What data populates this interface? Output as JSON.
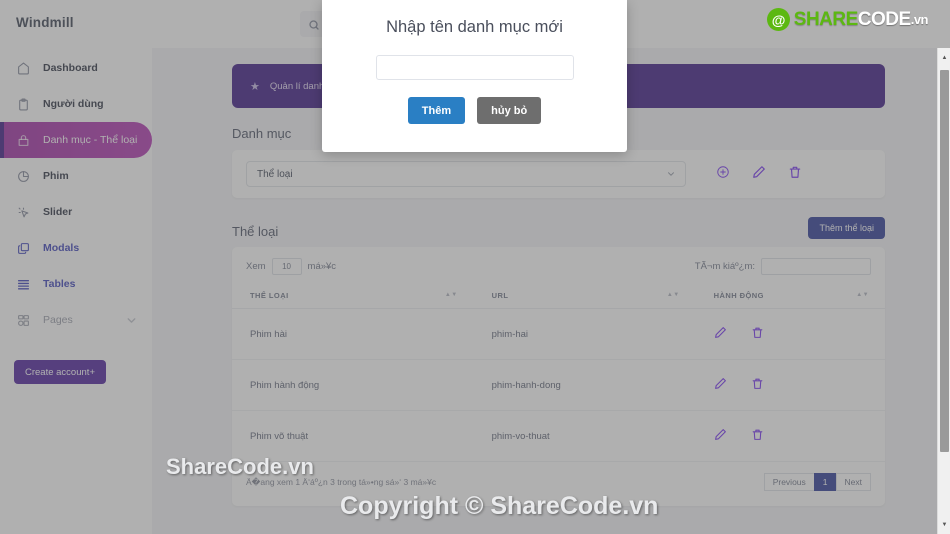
{
  "sidebar": {
    "brand": "Windmill",
    "items": [
      {
        "label": "Dashboard",
        "icon": "home-icon",
        "style": "dark"
      },
      {
        "label": "Người dùng",
        "icon": "clipboard-icon",
        "style": "dark"
      },
      {
        "label": "Danh mục - Thể loại",
        "icon": "bag-icon",
        "style": "active"
      },
      {
        "label": "Phim",
        "icon": "pie-chart-icon",
        "style": "dark"
      },
      {
        "label": "Slider",
        "icon": "cursor-icon",
        "style": "dark"
      },
      {
        "label": "Modals",
        "icon": "layers-icon",
        "style": "blue"
      },
      {
        "label": "Tables",
        "icon": "table-icon",
        "style": "blue"
      },
      {
        "label": "Pages",
        "icon": "grid-icon",
        "style": "muted"
      }
    ],
    "create_account_label": "Create account",
    "create_account_plus": "+"
  },
  "topbar": {
    "search_placeholder": "",
    "search_value": ""
  },
  "logo": {
    "share": "SHARE",
    "code": "CODE",
    "vn": ".vn",
    "mark": "@"
  },
  "banner": {
    "star": "★",
    "text": "Quản lí danh mục"
  },
  "section": {
    "category_heading": "Danh mục",
    "select_value": "Thể loại",
    "genre_heading": "Thể loại",
    "add_genre_button": "Thêm thể loại"
  },
  "table": {
    "length_prefix": "Xem",
    "length_value": "10",
    "length_suffix": "má»¥c",
    "filter_label": "TÃ¬m kiáº¿m:",
    "filter_value": "",
    "columns": [
      "THỂ LOẠI",
      "URL",
      "HÀNH ĐỘNG"
    ],
    "rows": [
      {
        "category": "Phim hài",
        "url": "phim-hai"
      },
      {
        "category": "Phim hành động",
        "url": "phim-hanh-dong"
      },
      {
        "category": "Phim võ thuật",
        "url": "phim-vo-thuat"
      }
    ],
    "info": "Ä�ang xem 1 Ä‘áº¿n 3 trong tá»•ng sá»‘ 3 má»¥c",
    "pagination": {
      "previous": "Previous",
      "current": "1",
      "next": "Next"
    }
  },
  "modal": {
    "title": "Nhập tên danh mục mới",
    "input_value": "",
    "input_placeholder": "",
    "confirm_label": "Thêm",
    "cancel_label": "hủy bỏ"
  },
  "watermarks": {
    "middle": "ShareCode.vn",
    "bottom": "Copyright © ShareCode.vn"
  },
  "colors": {
    "accent_purple": "#4c2a8f",
    "active_magenta": "#b846b8",
    "primary_blue": "#2a7fc4",
    "indigo": "#3c4a9e",
    "action_purple": "#7e3ff2",
    "logo_green": "#5cb811"
  }
}
